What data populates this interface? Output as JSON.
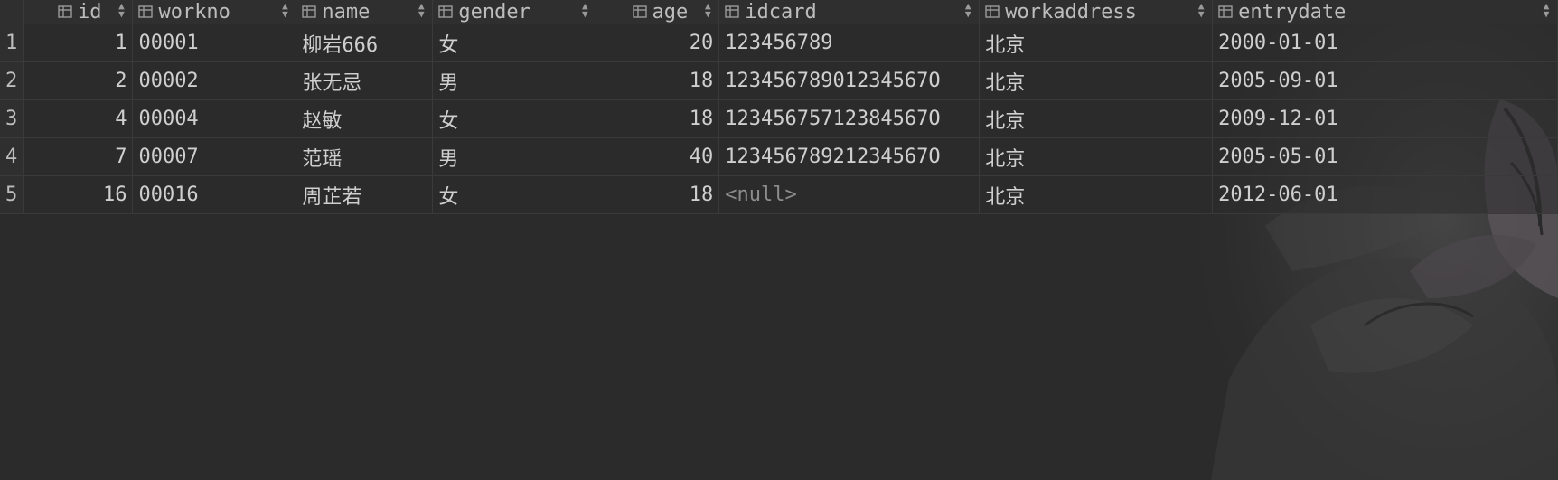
{
  "columns": [
    {
      "name": "id",
      "align": "right"
    },
    {
      "name": "workno",
      "align": "left"
    },
    {
      "name": "name",
      "align": "left"
    },
    {
      "name": "gender",
      "align": "left"
    },
    {
      "name": "age",
      "align": "right"
    },
    {
      "name": "idcard",
      "align": "left"
    },
    {
      "name": "workaddress",
      "align": "left"
    },
    {
      "name": "entrydate",
      "align": "left"
    }
  ],
  "rows": [
    {
      "rownum": "1",
      "cells": [
        "1",
        "00001",
        "柳岩666",
        "女",
        "20",
        "123456789",
        "北京",
        "2000-01-01"
      ]
    },
    {
      "rownum": "2",
      "cells": [
        "2",
        "00002",
        "张无忌",
        "男",
        "18",
        "12345678901234567O",
        "北京",
        "2005-09-01"
      ]
    },
    {
      "rownum": "3",
      "cells": [
        "4",
        "00004",
        "赵敏",
        "女",
        "18",
        "12345675712384567O",
        "北京",
        "2009-12-01"
      ]
    },
    {
      "rownum": "4",
      "cells": [
        "7",
        "00007",
        "范瑶",
        "男",
        "40",
        "12345678921234567O",
        "北京",
        "2005-05-01"
      ]
    },
    {
      "rownum": "5",
      "cells": [
        "16",
        "00016",
        "周芷若",
        "女",
        "18",
        "<null>",
        "北京",
        "2012-06-01"
      ]
    }
  ],
  "null_text": "<null>",
  "colors": {
    "background": "#2b2b2b",
    "text": "#cfcfcf",
    "null_text": "#8c8c8c",
    "grid_line": "#3a3a3a"
  },
  "icons": {
    "column_header": "table-column-icon",
    "sort": "sort-toggle-icon",
    "wallpaper": "butterfly-wallpaper-icon"
  }
}
